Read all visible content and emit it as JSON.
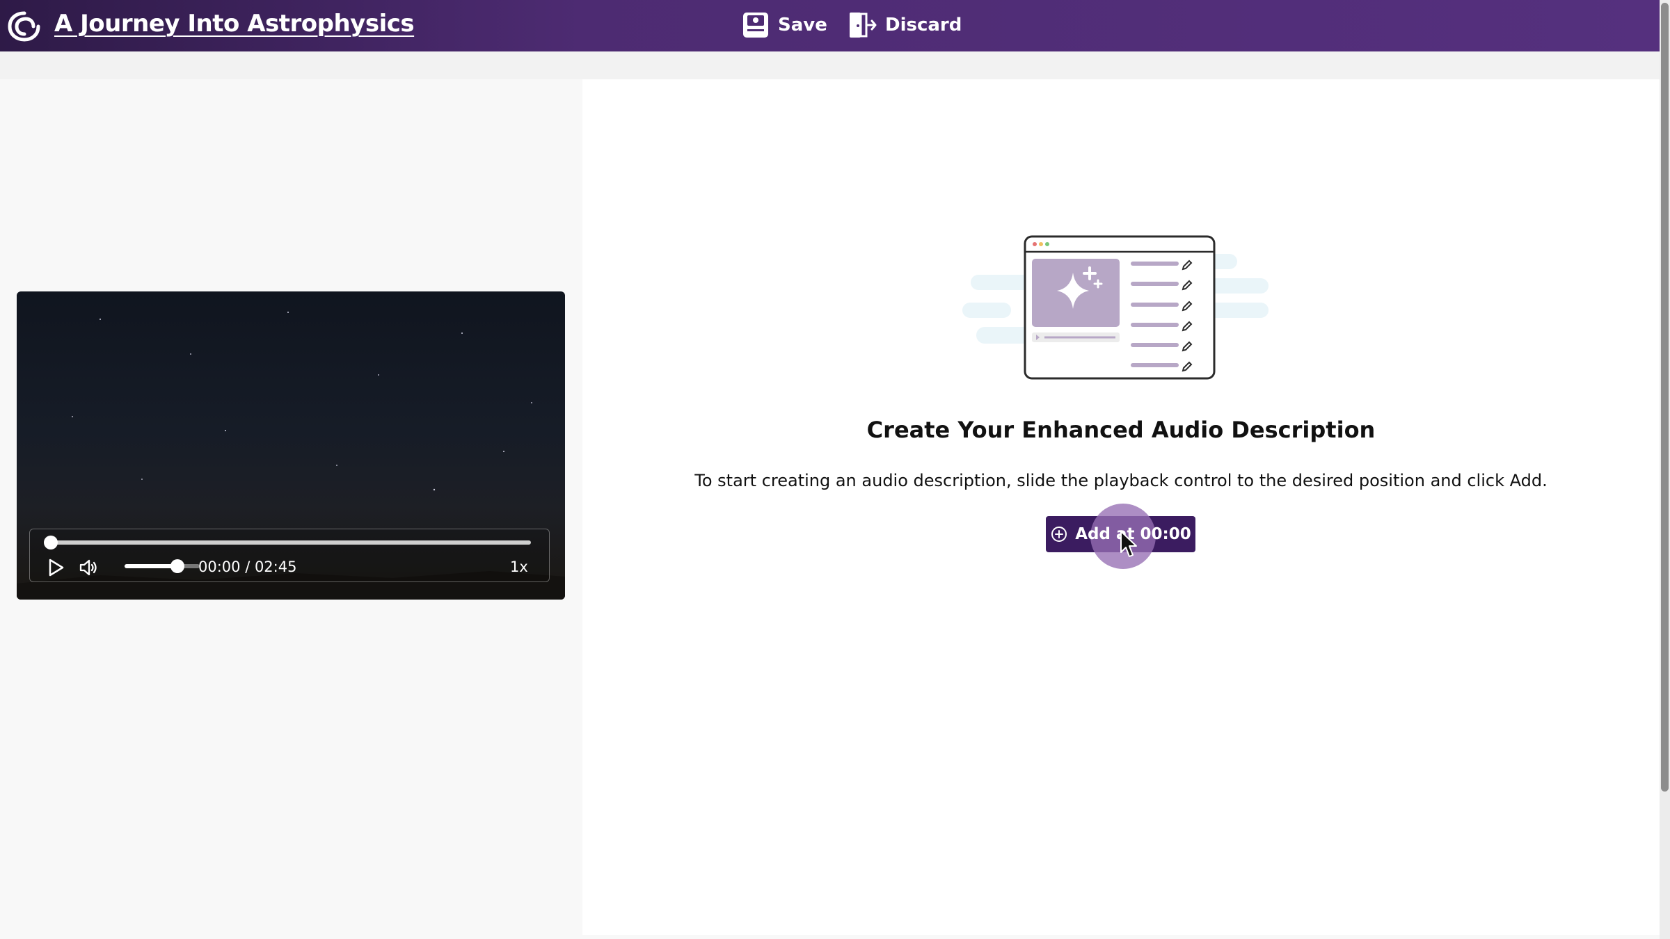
{
  "header": {
    "app_title": "A Journey Into Astrophysics",
    "save_label": "Save",
    "discard_label": "Discard",
    "logo_icon": "swirl-logo-icon",
    "save_icon": "save-disk-icon",
    "discard_icon": "door-exit-icon",
    "accent": "#4d2b72"
  },
  "player": {
    "time_display": "00:00 / 02:45",
    "speed_label": "1x",
    "progress": 0,
    "volume": 0.7,
    "icons": [
      "play-icon",
      "volume-icon"
    ]
  },
  "main": {
    "heading": "Create Your Enhanced Audio Description",
    "instruction": "To start creating an audio description, slide the playback control to the desired position and click Add.",
    "add_button_label": "Add at 00:00",
    "add_button_color": "#3b1c60",
    "illustration": "editor-window-illustration"
  }
}
